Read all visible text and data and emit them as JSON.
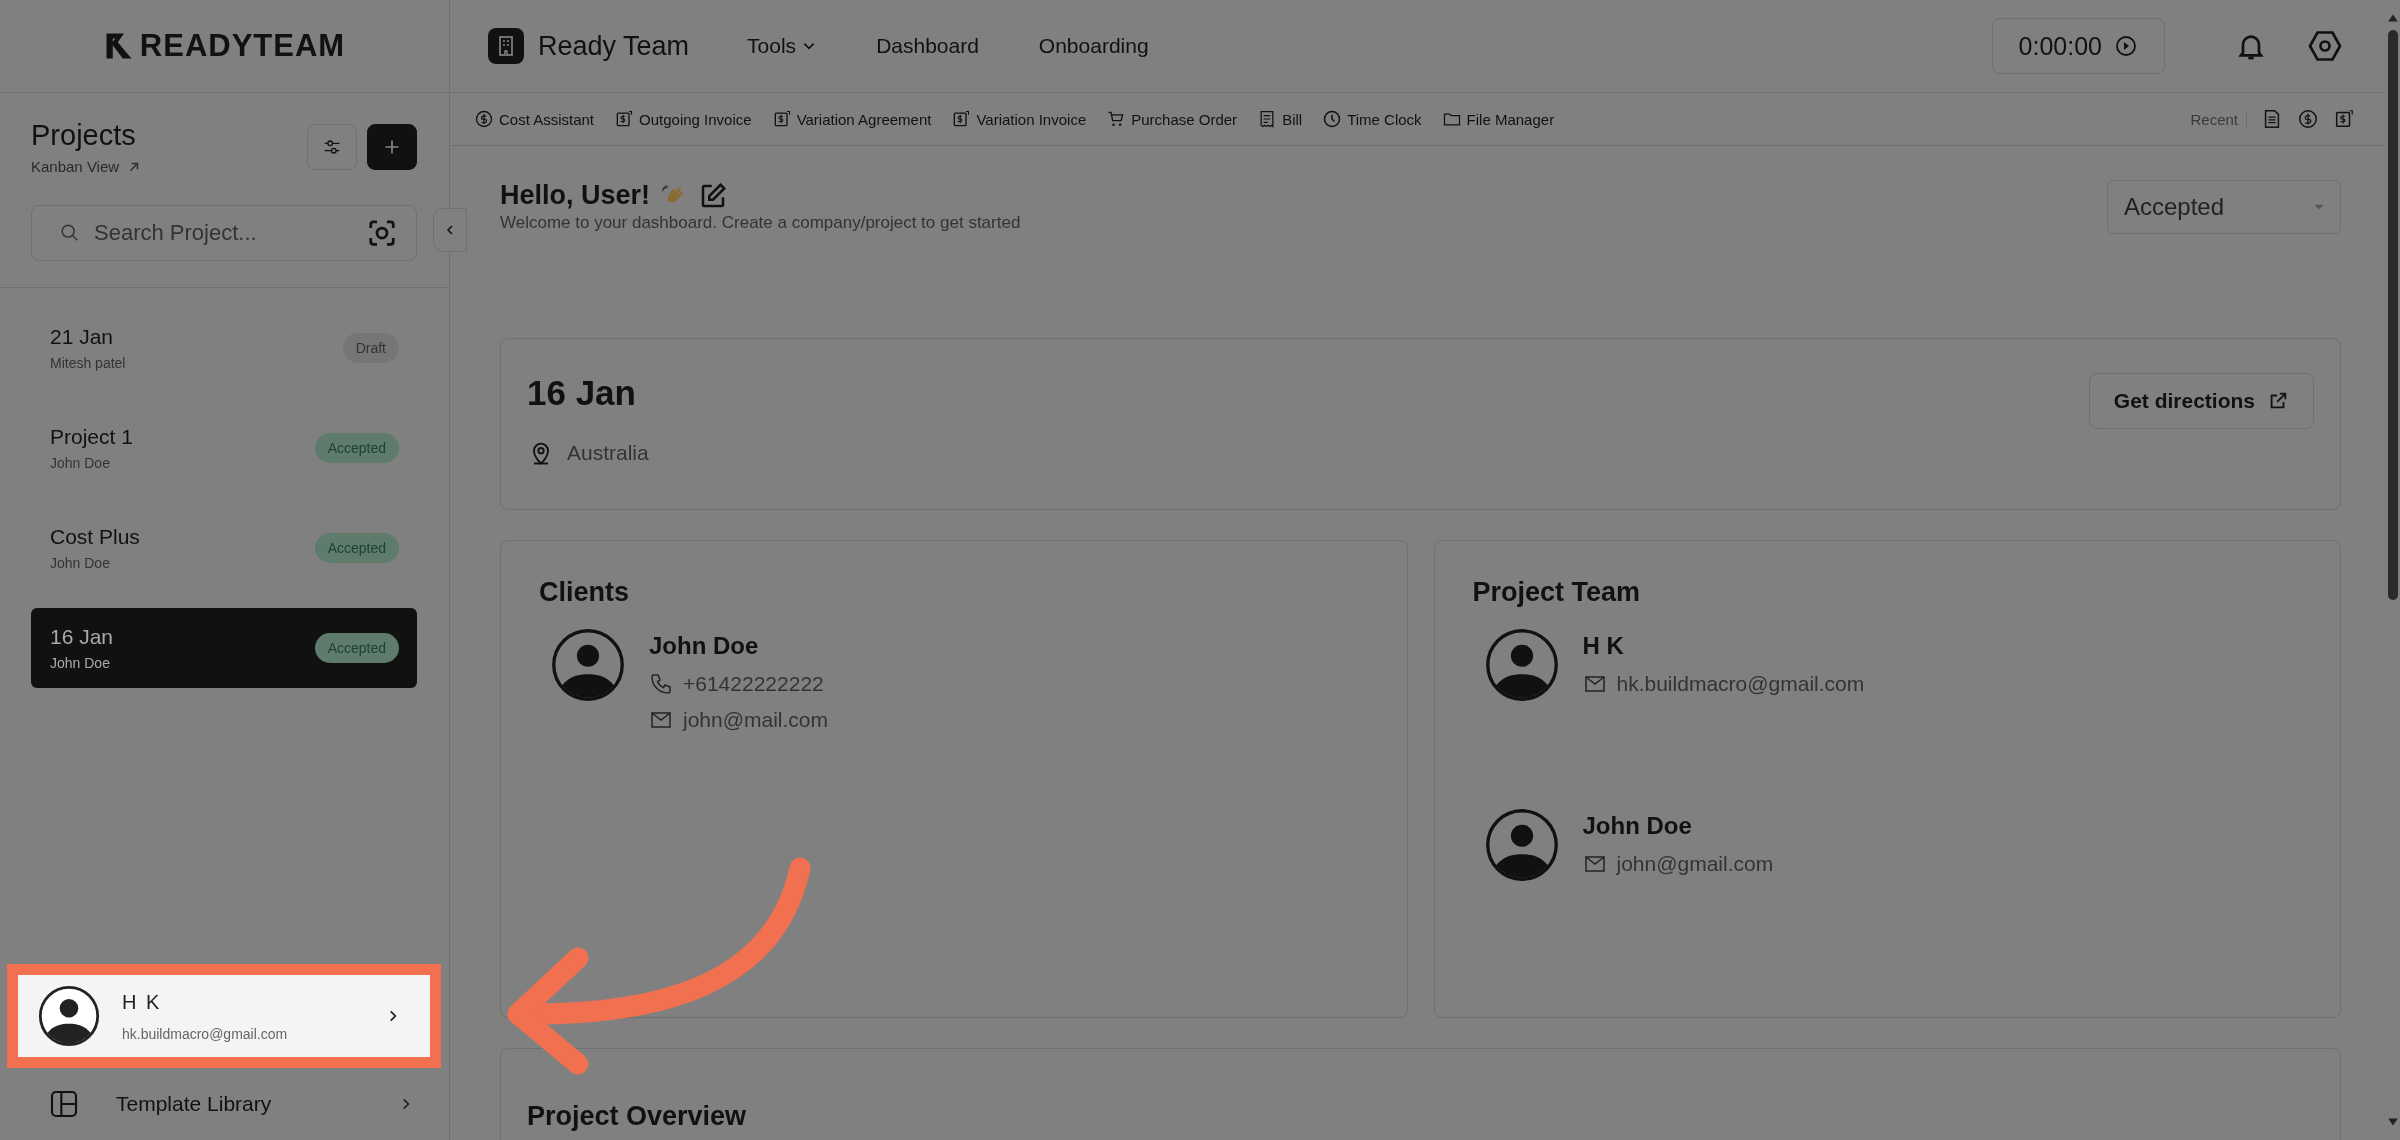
{
  "logo": "READYTEAM",
  "nav": {
    "workspace": "Ready Team",
    "timer": "0:00:00",
    "items": [
      {
        "label": "Tools",
        "dropdown": true
      },
      {
        "label": "Dashboard",
        "dropdown": false
      },
      {
        "label": "Onboarding",
        "dropdown": false
      }
    ]
  },
  "toolbar": {
    "recent_label": "Recent",
    "items": [
      {
        "label": "Cost Assistant",
        "kind": "dollar"
      },
      {
        "label": "Outgoing Invoice",
        "kind": "invoice"
      },
      {
        "label": "Variation Agreement",
        "kind": "invoice"
      },
      {
        "label": "Variation Invoice",
        "kind": "invoice"
      },
      {
        "label": "Purchase Order",
        "kind": "cart"
      },
      {
        "label": "Bill",
        "kind": "receipt"
      },
      {
        "label": "Time Clock",
        "kind": "clock"
      },
      {
        "label": "File Manager",
        "kind": "folder"
      }
    ],
    "recent": [
      {
        "kind": "document"
      },
      {
        "kind": "dollar"
      },
      {
        "kind": "invoice"
      }
    ]
  },
  "sidebar": {
    "title": "Projects",
    "view_link": "Kanban View",
    "search": {
      "placeholder": "Search Project..."
    },
    "projects": [
      {
        "name": "21 Jan",
        "owner": "Mitesh patel",
        "status": "Draft",
        "kind": "draft",
        "selected": false
      },
      {
        "name": "Project 1",
        "owner": "John Doe",
        "status": "Accepted",
        "kind": "accepted",
        "selected": false
      },
      {
        "name": "Cost Plus",
        "owner": "John Doe",
        "status": "Accepted",
        "kind": "accepted",
        "selected": false
      },
      {
        "name": "16 Jan",
        "owner": "John Doe",
        "status": "Accepted",
        "kind": "accepted",
        "selected": true
      }
    ],
    "user": {
      "name": "H K",
      "email": "hk.buildmacro@gmail.com",
      "highlighted": true
    },
    "footer_item": "Template Library"
  },
  "main": {
    "greeting": "Hello, User!",
    "subtitle": "Welcome to your dashboard. Create a company/project to get started",
    "status_filter": "Accepted",
    "project": {
      "name": "16 Jan",
      "location": "Australia",
      "action": "Get directions"
    },
    "clients": {
      "title": "Clients",
      "people": [
        {
          "name": "John Doe",
          "phone": "+61422222222",
          "email": "john@mail.com"
        }
      ]
    },
    "team": {
      "title": "Project Team",
      "people": [
        {
          "name": "H K",
          "email": "hk.buildmacro@gmail.com"
        },
        {
          "name": "John Doe",
          "email": "john@gmail.com"
        }
      ]
    },
    "overview_title": "Project Overview"
  }
}
